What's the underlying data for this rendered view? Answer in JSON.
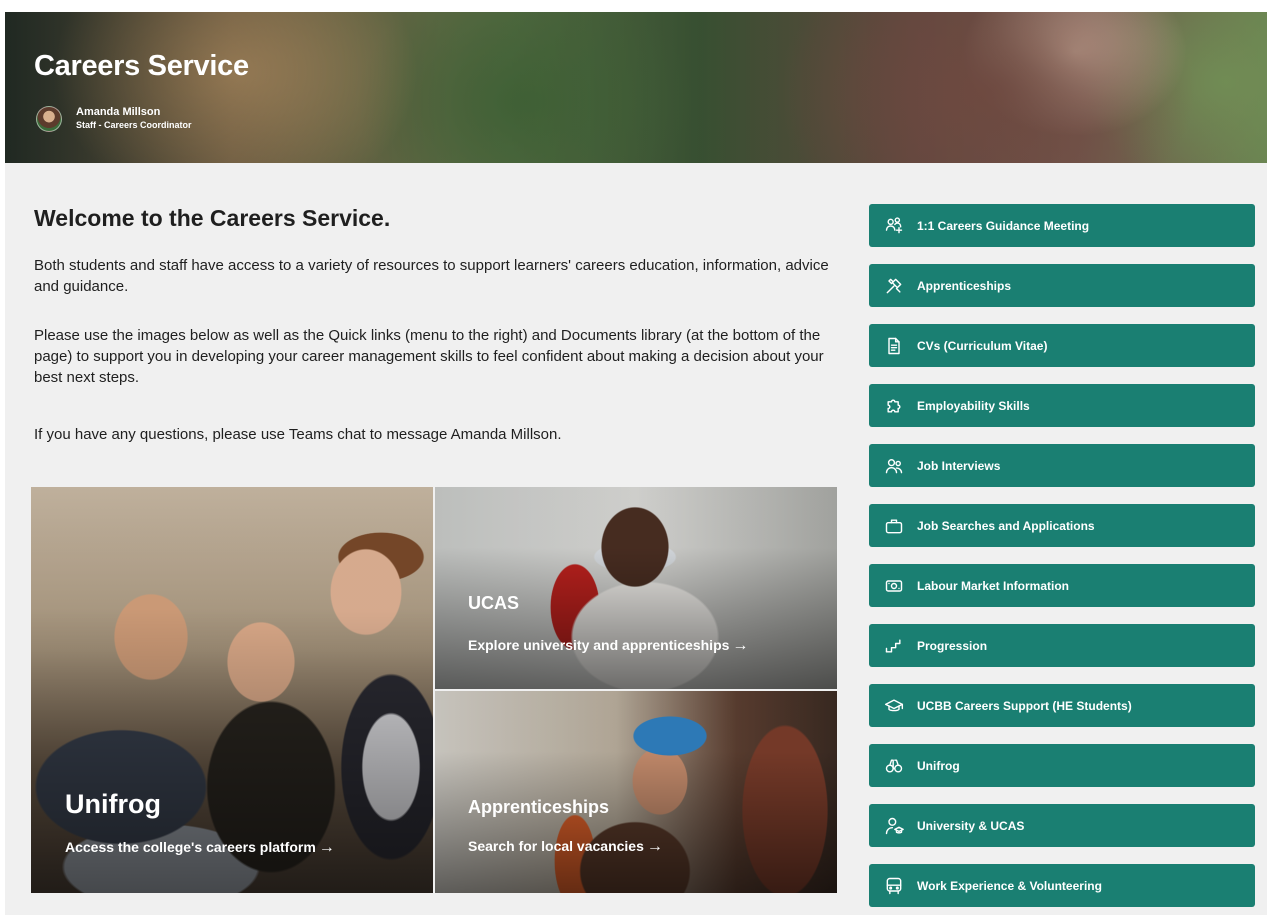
{
  "banner": {
    "title": "Careers Service",
    "author_name": "Amanda Millson",
    "author_role": "Staff - Careers Coordinator"
  },
  "welcome": {
    "title": "Welcome to the Careers Service.",
    "paragraph_1": "Both students and staff have access to a variety of resources to support learners' careers education, information, advice and guidance.",
    "paragraph_2": "Please use the images below as well as the Quick links (menu to the right) and Documents library (at the bottom of the page) to support you in developing your career management skills to feel confident about making a decision about your best next steps.",
    "paragraph_3": "If you have any questions, please use Teams chat to message Amanda Millson."
  },
  "tiles": [
    {
      "title": "Unifrog",
      "link": "Access the college's careers platform"
    },
    {
      "title": "UCAS",
      "link": "Explore university and apprenticeships"
    },
    {
      "title": "Apprenticeships",
      "link": "Search for local vacancies"
    }
  ],
  "arrow": "→",
  "quick_links": [
    {
      "label": "1:1 Careers Guidance Meeting",
      "icon": "people-meeting-icon"
    },
    {
      "label": "Apprenticeships",
      "icon": "tools-icon"
    },
    {
      "label": "CVs (Curriculum Vitae)",
      "icon": "document-icon"
    },
    {
      "label": "Employability Skills",
      "icon": "puzzle-icon"
    },
    {
      "label": "Job Interviews",
      "icon": "people-icon"
    },
    {
      "label": "Job Searches and Applications",
      "icon": "briefcase-icon"
    },
    {
      "label": "Labour Market Information",
      "icon": "money-icon"
    },
    {
      "label": "Progression",
      "icon": "steps-icon"
    },
    {
      "label": "UCBB Careers Support (HE Students)",
      "icon": "graduation-cap-icon"
    },
    {
      "label": "Unifrog",
      "icon": "binoculars-icon"
    },
    {
      "label": "University & UCAS",
      "icon": "person-graduation-icon"
    },
    {
      "label": "Work Experience & Volunteering",
      "icon": "vehicle-icon"
    }
  ],
  "colors": {
    "quick_link_bg": "#1a7f72",
    "page_bg": "#f0f0f0"
  }
}
